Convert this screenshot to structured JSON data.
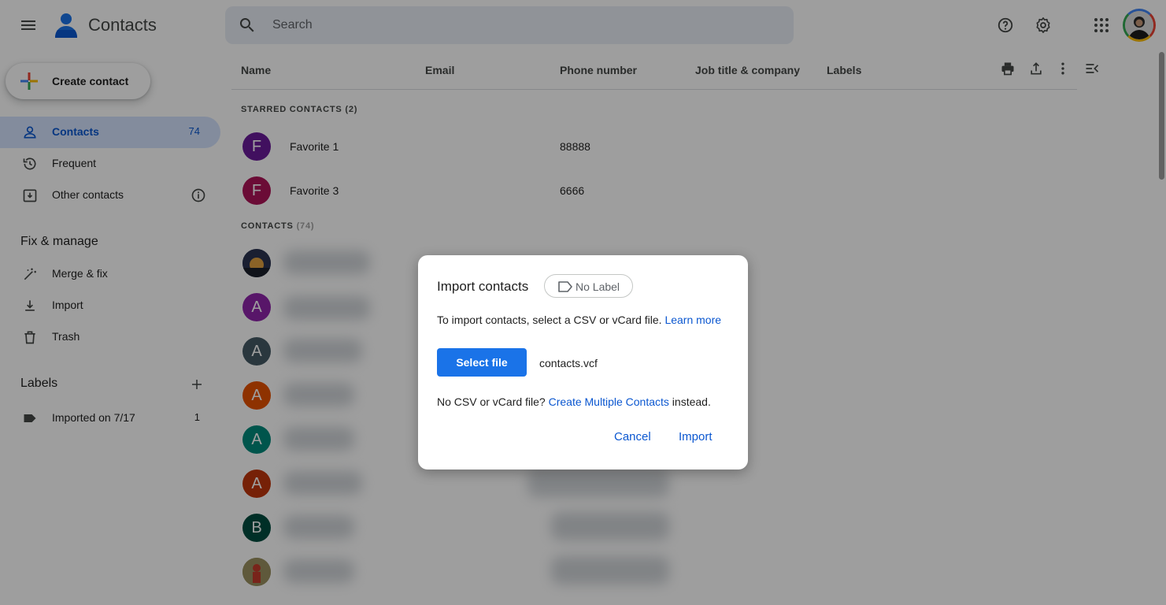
{
  "header": {
    "title": "Contacts",
    "search_placeholder": "Search",
    "icons": [
      "menu-icon",
      "help-icon",
      "gear-icon",
      "apps-grid-icon"
    ]
  },
  "sidebar": {
    "create_label": "Create contact",
    "items": [
      {
        "label": "Contacts",
        "count": "74",
        "icon": "person-icon",
        "active": true
      },
      {
        "label": "Frequent",
        "icon": "history-icon"
      },
      {
        "label": "Other contacts",
        "icon": "archive-icon"
      }
    ],
    "fix_title": "Fix & manage",
    "fix_items": [
      {
        "label": "Merge & fix",
        "icon": "magic-wand-icon"
      },
      {
        "label": "Import",
        "icon": "download-icon"
      },
      {
        "label": "Trash",
        "icon": "trash-icon"
      }
    ],
    "labels_title": "Labels",
    "labels": [
      {
        "label": "Imported on 7/17",
        "count": "1",
        "icon": "label-icon"
      }
    ]
  },
  "table": {
    "columns": [
      "Name",
      "Email",
      "Phone number",
      "Job title & company",
      "Labels"
    ],
    "starred_header": "STARRED CONTACTS (2)",
    "starred": [
      {
        "initial": "F",
        "name": "Favorite 1",
        "phone": "88888",
        "color": "#6a1b9a"
      },
      {
        "initial": "F",
        "name": "Favorite 3",
        "phone": "6666",
        "color": "#ad1457"
      }
    ],
    "contacts_header": "CONTACTS",
    "contacts_count": "(74)",
    "contact_avatars": [
      {
        "initial": "",
        "color": "#3c4a6b"
      },
      {
        "initial": "A",
        "color": "#8e24aa"
      },
      {
        "initial": "A",
        "color": "#455a64"
      },
      {
        "initial": "A",
        "color": "#e65100"
      },
      {
        "initial": "A",
        "color": "#00897b"
      },
      {
        "initial": "A",
        "color": "#bf360c"
      },
      {
        "initial": "B",
        "color": "#004d40"
      },
      {
        "initial": "",
        "color": "#8d8a5c"
      }
    ]
  },
  "dialog": {
    "title": "Import contacts",
    "chip_label": "No Label",
    "instruction": "To import contacts, select a CSV or vCard file.",
    "learn_more": "Learn more",
    "select_file": "Select file",
    "file_name": "contacts.vcf",
    "alt_prefix": "No CSV or vCard file?",
    "alt_link": "Create Multiple Contacts",
    "alt_suffix": "instead.",
    "cancel": "Cancel",
    "import": "Import"
  },
  "colors": {
    "accent": "#1a73e8",
    "link": "#0b57d0",
    "active_nav_bg": "#d3e3fd",
    "search_bg": "#e9eef6"
  }
}
